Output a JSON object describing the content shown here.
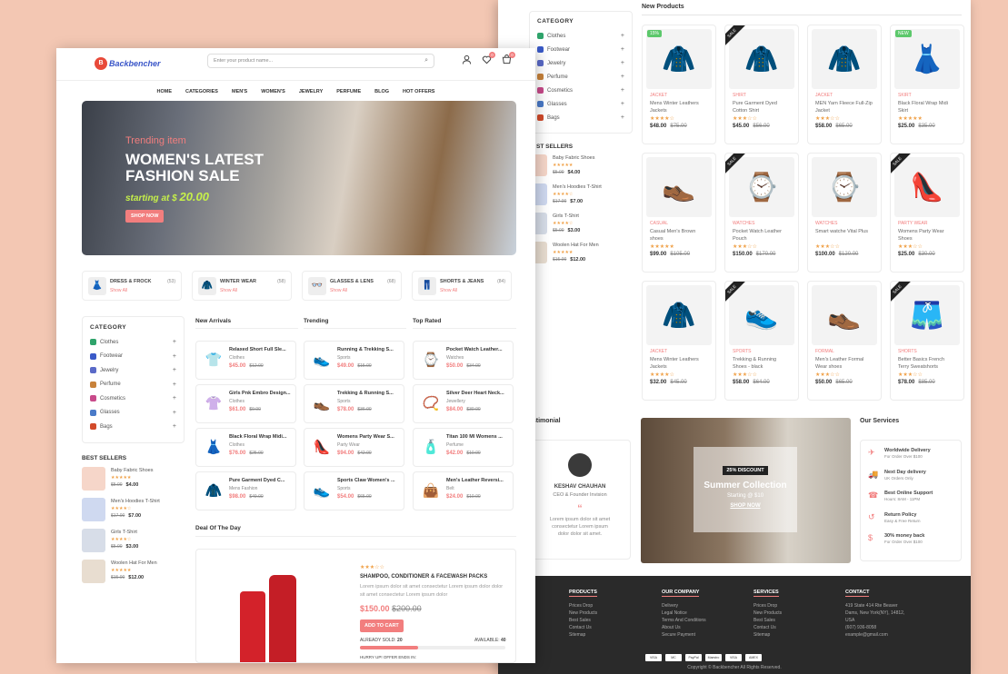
{
  "back": {
    "new_products_title": "New Products",
    "category_title": "CATEGORY",
    "categories": [
      {
        "label": "Clothes",
        "color": "#2fa36b"
      },
      {
        "label": "Footwear",
        "color": "#3a5ac8"
      },
      {
        "label": "Jewelry",
        "color": "#5a6ac8"
      },
      {
        "label": "Perfume",
        "color": "#c8823a"
      },
      {
        "label": "Cosmetics",
        "color": "#c84a8a"
      },
      {
        "label": "Glasses",
        "color": "#4a7ac8"
      },
      {
        "label": "Bags",
        "color": "#d24a2a"
      }
    ],
    "plus": "+",
    "best_sellers_title": "ST SELLERS",
    "best_sellers": [
      {
        "name": "Baby Fabric Shoes",
        "stars": "★★★★★",
        "old": "$5.00",
        "price": "$4.00"
      },
      {
        "name": "Men's Hoodies T-Shirt",
        "stars": "★★★★☆",
        "old": "$17.00",
        "price": "$7.00"
      },
      {
        "name": "Girls T-Shirt",
        "stars": "★★★★☆",
        "old": "$5.00",
        "price": "$3.00"
      },
      {
        "name": "Woolen Hat For Men",
        "stars": "★★★★★",
        "old": "$15.00",
        "price": "$12.00"
      }
    ],
    "products": [
      {
        "cat": "JACKET",
        "name": "Mens Winter Leathers Jackets",
        "stars": "★★★★☆",
        "price": "$48.00",
        "old": "$75.00",
        "badge": "15%",
        "icon": "🧥",
        "bg": "#f3f3f3"
      },
      {
        "cat": "SHIRT",
        "name": "Pure Garment Dyed Cotton Shirt",
        "stars": "★★★☆☆",
        "price": "$45.00",
        "old": "$56.00",
        "ribbon": "SALE",
        "icon": "🧥",
        "bg": "#f3f3f3"
      },
      {
        "cat": "JACKET",
        "name": "MEN Yarn Fleece Full-Zip Jacket",
        "stars": "★★★☆☆",
        "price": "$58.00",
        "old": "$65.00",
        "icon": "🧥",
        "bg": "#f3f3f3"
      },
      {
        "cat": "SKIRT",
        "name": "Black Floral Wrap Midi Skirt",
        "stars": "★★★★★",
        "price": "$25.00",
        "old": "$35.00",
        "badge": "NEW",
        "icon": "👗",
        "bg": "#f3f3f3"
      },
      {
        "cat": "CASUAL",
        "name": "Casual Men's Brown shoes",
        "stars": "★★★★★",
        "price": "$99.00",
        "old": "$105.00",
        "icon": "👞",
        "bg": "#f3f3f3"
      },
      {
        "cat": "WATCHES",
        "name": "Pocket Watch Leather Pouch",
        "stars": "★★★☆☆",
        "price": "$150.00",
        "old": "$170.00",
        "ribbon": "SALE",
        "icon": "⌚",
        "bg": "#f3f3f3"
      },
      {
        "cat": "WATCHES",
        "name": "Smart watche Vital Plus",
        "stars": "★★★☆☆",
        "price": "$100.00",
        "old": "$120.00",
        "icon": "⌚",
        "bg": "#f3f3f3"
      },
      {
        "cat": "PARTY WEAR",
        "name": "Womens Party Wear Shoes",
        "stars": "★★★☆☆",
        "price": "$25.00",
        "old": "$30.00",
        "ribbon": "SALE",
        "icon": "👠",
        "bg": "#f3f3f3"
      },
      {
        "cat": "JACKET",
        "name": "Mens Winter Leathers Jackets",
        "stars": "★★★★☆",
        "price": "$32.00",
        "old": "$45.00",
        "icon": "🧥",
        "bg": "#f3f3f3"
      },
      {
        "cat": "SPORTS",
        "name": "Trekking & Running Shoes - black",
        "stars": "★★★☆☆",
        "price": "$58.00",
        "old": "$64.00",
        "ribbon": "SALE",
        "icon": "👟",
        "bg": "#f3f3f3"
      },
      {
        "cat": "FORMAL",
        "name": "Men's Leather Formal Wear shoes",
        "stars": "★★★☆☆",
        "price": "$50.00",
        "old": "$65.00",
        "icon": "👞",
        "bg": "#f3f3f3"
      },
      {
        "cat": "SHORTS",
        "name": "Better Basics French Terry Sweatshorts",
        "stars": "★★★☆☆",
        "price": "$78.00",
        "old": "$85.00",
        "ribbon": "SALE",
        "icon": "🩳",
        "bg": "#f3f3f3"
      }
    ],
    "testimonial_title": "estimonial",
    "testimonial": {
      "name": "KESHAV CHAUHAN",
      "role": "CEO & Founder Invision",
      "quote_mark": "“",
      "text": "Lorem ipsum dolor sit amet consectetur Lorem ipsum dolor dolor sit amet."
    },
    "banner": {
      "discount": "25% DISCOUNT",
      "heading": "Summer Collection",
      "sub": "Starting @ $10",
      "button": "SHOP NOW"
    },
    "services_title": "Our Services",
    "services": [
      {
        "t1": "Worldwide Delivery",
        "t2": "For Order Over $100",
        "icon": "✈"
      },
      {
        "t1": "Next Day delivery",
        "t2": "UK Orders Only",
        "icon": "🚚"
      },
      {
        "t1": "Best Online Support",
        "t2": "Hours: 8AM - 11PM",
        "icon": "☎"
      },
      {
        "t1": "Return Policy",
        "t2": "Easy & Free Return",
        "icon": "↺"
      },
      {
        "t1": "30% money back",
        "t2": "For Order Over $100",
        "icon": "$"
      }
    ],
    "footer": {
      "cols": [
        {
          "title": "S",
          "items": []
        },
        {
          "title": "PRODUCTS",
          "items": [
            "Prices Drop",
            "New Products",
            "Best Sales",
            "Contact Us",
            "Sitemap"
          ]
        },
        {
          "title": "OUR COMPANY",
          "items": [
            "Delivery",
            "Legal Notice",
            "Terms And Conditions",
            "About Us",
            "Secure Payment"
          ]
        },
        {
          "title": "SERVICES",
          "items": [
            "Prices Drop",
            "New Products",
            "Best Sales",
            "Contact Us",
            "Sitemap"
          ]
        },
        {
          "title": "CONTACT",
          "items": [
            "419 State 414 Rte Beaver",
            "Dams, New York(NY), 14812,",
            "USA",
            "(607) 936-8058",
            "example@gmail.com"
          ]
        }
      ],
      "payments": [
        "VISA",
        "MC",
        "PayPal",
        "Maestro",
        "VISA",
        "AMEX"
      ],
      "copyright": "Copyright © Backbencher All Rights Reserved."
    }
  },
  "front": {
    "logo_text": "Backbencher",
    "search_placeholder": "Enter your product name...",
    "wishlist_count": "0",
    "cart_count": "0",
    "nav": [
      "HOME",
      "CATEGORIES",
      "MEN'S",
      "WOMEN'S",
      "JEWELRY",
      "PERFUME",
      "BLOG",
      "HOT OFFERS"
    ],
    "hero": {
      "kicker": "Trending item",
      "title": "WOMEN'S LATEST FASHION SALE",
      "starting": "starting at $",
      "price": "20.00",
      "button": "SHOP NOW"
    },
    "category_boxes": [
      {
        "name": "DRESS & FROCK",
        "count": "(53)",
        "link": "Show All",
        "icon": "👗"
      },
      {
        "name": "WINTER WEAR",
        "count": "(58)",
        "link": "Show All",
        "icon": "🧥"
      },
      {
        "name": "GLASSES & LENS",
        "count": "(68)",
        "link": "Show All",
        "icon": "👓"
      },
      {
        "name": "SHORTS & JEANS",
        "count": "(84)",
        "link": "Show All",
        "icon": "👖"
      }
    ],
    "category_title": "CATEGORY",
    "best_sellers_title": "BEST SELLERS",
    "sections": [
      {
        "title": "New Arrivals",
        "items": [
          {
            "name": "Relaxed Short Full Sle...",
            "cat": "Clothes",
            "price": "$45.00",
            "old": "$12.00",
            "icon": "👕"
          },
          {
            "name": "Girls Pnk Embro Design...",
            "cat": "Clothes",
            "price": "$61.00",
            "old": "$9.00",
            "icon": "👚"
          },
          {
            "name": "Black Floral Wrap Midi...",
            "cat": "Clothes",
            "price": "$76.00",
            "old": "$25.00",
            "icon": "👗"
          },
          {
            "name": "Pure Garment Dyed C...",
            "cat": "Mens Fashion",
            "price": "$98.00",
            "old": "$49.00",
            "icon": "🧥"
          }
        ]
      },
      {
        "title": "Trending",
        "items": [
          {
            "name": "Running & Trekking S...",
            "cat": "Sports",
            "price": "$49.00",
            "old": "$15.00",
            "icon": "👟"
          },
          {
            "name": "Trekking & Running S...",
            "cat": "Sports",
            "price": "$78.00",
            "old": "$36.00",
            "icon": "👞"
          },
          {
            "name": "Womens Party Wear S...",
            "cat": "Party Wear",
            "price": "$94.00",
            "old": "$42.00",
            "icon": "👠"
          },
          {
            "name": "Sports Claw Women's ...",
            "cat": "Sports",
            "price": "$54.00",
            "old": "$65.00",
            "icon": "👟"
          }
        ]
      },
      {
        "title": "Top Rated",
        "items": [
          {
            "name": "Pocket Watch Leather...",
            "cat": "Watches",
            "price": "$50.00",
            "old": "$34.00",
            "icon": "⌚"
          },
          {
            "name": "Silver Deer Heart Neck...",
            "cat": "Jewellery",
            "price": "$84.00",
            "old": "$30.00",
            "icon": "📿"
          },
          {
            "name": "Titan 100 Ml Womens ...",
            "cat": "Perfume",
            "price": "$42.00",
            "old": "$10.00",
            "icon": "🧴"
          },
          {
            "name": "Men's Leather Reversi...",
            "cat": "Belt",
            "price": "$24.00",
            "old": "$10.00",
            "icon": "👜"
          }
        ]
      }
    ],
    "deal": {
      "title": "Deal Of The Day",
      "stars": "★★★☆☆",
      "name": "SHAMPOO, CONDITIONER & FACEWASH PACKS",
      "desc": "Lorem ipsum dolor sit amet consectetur Lorem ipsum dolor dolor sit amet consectetur Lorem ipsum dolor",
      "price": "$150.00",
      "old": "$200.00",
      "button": "ADD TO CART",
      "sold_label": "ALREADY SOLD:",
      "sold": "20",
      "avail_label": "AVAILABLE:",
      "avail": "40",
      "sold_fraction": 0.4,
      "hurry": "HURRY UP! OFFER ENDS IN:"
    }
  }
}
